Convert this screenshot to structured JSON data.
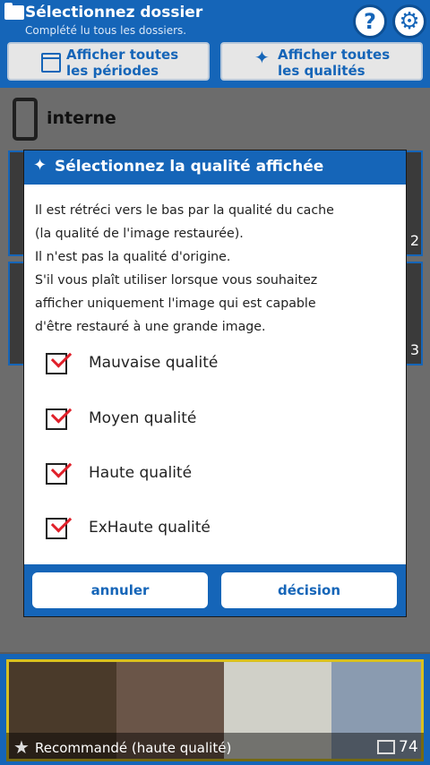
{
  "header": {
    "title": "Sélectionnez dossier",
    "subtitle": "Complété lu tous les dossiers.",
    "help_label": "?",
    "gear_label": "⚙",
    "filter_period": "Afficher toutes\nles périodes",
    "filter_quality": "Afficher toutes\nles qualités"
  },
  "device": {
    "label": "interne"
  },
  "thumb_counts": {
    "right_1": "2",
    "right_2": "3"
  },
  "dialog": {
    "title": "Sélectionnez la qualité affichée",
    "description": "Il est rétréci vers le bas par la qualité du cache\n(la qualité de l'image restaurée).\nIl n'est pas la qualité d'origine.\nS'il vous plaît utiliser lorsque vous souhaitez\nafficher uniquement l'image qui est capable\nd'être restauré à une grande image.",
    "options": [
      {
        "label": "Mauvaise qualité",
        "checked": true
      },
      {
        "label": "Moyen qualité",
        "checked": true
      },
      {
        "label": "Haute qualité",
        "checked": true
      },
      {
        "label": "ExHaute qualité",
        "checked": true
      }
    ],
    "cancel_label": "annuler",
    "ok_label": "décision"
  },
  "recommended": {
    "label": "Recommandé (haute qualité)",
    "count": "74"
  },
  "colors": {
    "primary": "#1565b8",
    "check": "#e0202a",
    "highlight": "#d8c020"
  }
}
